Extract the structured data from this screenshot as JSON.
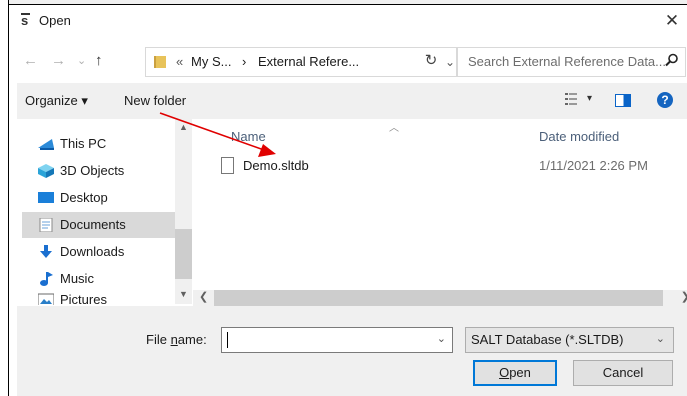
{
  "window": {
    "title": "Open",
    "close_glyph": "✕"
  },
  "nav": {
    "back": "←",
    "forward": "→",
    "recent": "⌄",
    "up": "↑",
    "breadcrumbs": [
      "«",
      "My S...",
      "›",
      "External Refere..."
    ],
    "address_dropdown": "⌄",
    "refresh": "↻",
    "search_placeholder": "Search External Reference Data...",
    "search_icon": "search-icon"
  },
  "toolbar": {
    "organize": "Organize ▾",
    "new_folder": "New folder",
    "help": "?"
  },
  "sidebar": {
    "items": [
      {
        "label": "This PC",
        "icon": "computer-icon",
        "selected": false
      },
      {
        "label": "3D Objects",
        "icon": "cube-icon",
        "selected": false
      },
      {
        "label": "Desktop",
        "icon": "desktop-icon",
        "selected": false
      },
      {
        "label": "Documents",
        "icon": "document-icon",
        "selected": true
      },
      {
        "label": "Downloads",
        "icon": "download-icon",
        "selected": false
      },
      {
        "label": "Music",
        "icon": "music-icon",
        "selected": false
      },
      {
        "label": "Pictures",
        "icon": "picture-icon",
        "selected": false
      }
    ]
  },
  "files": {
    "columns": [
      "Name",
      "Date modified"
    ],
    "rows": [
      {
        "name": "Demo.sltdb",
        "date": "1/11/2021 2:26 PM"
      }
    ]
  },
  "footer": {
    "file_name_label_pre": "File ",
    "file_name_label_underlined": "n",
    "file_name_label_post": "ame:",
    "file_name_value": "",
    "filter_value": "SALT Database (*.SLTDB)",
    "open_underlined": "O",
    "open_rest": "pen",
    "cancel": "Cancel"
  },
  "colors": {
    "annotation_arrow": "#e00000",
    "accent": "#0078d7"
  }
}
